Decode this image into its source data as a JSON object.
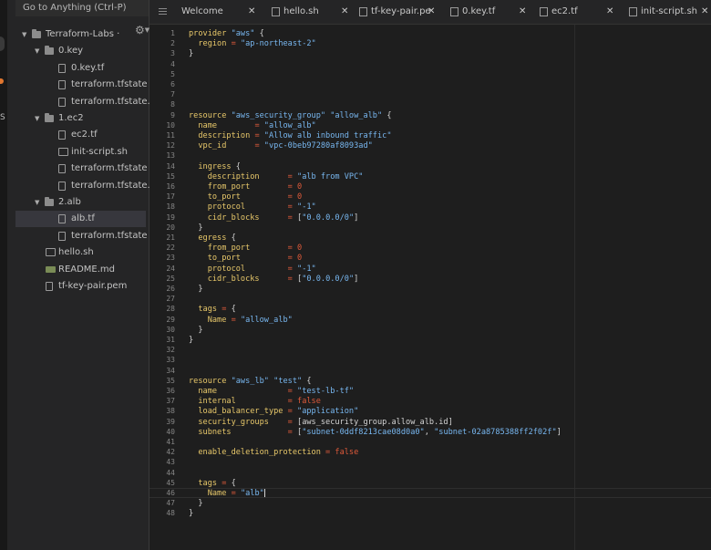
{
  "search": {
    "placeholder": "Go to Anything (Ctrl-P)"
  },
  "tree": [
    {
      "label": "Terraform-Labs ·",
      "type": "folder",
      "expanded": true,
      "depth": 0,
      "icon": "folder-icon"
    },
    {
      "label": "0.key",
      "type": "folder",
      "expanded": true,
      "depth": 1,
      "icon": "folder-icon"
    },
    {
      "label": "0.key.tf",
      "type": "file",
      "depth": 2,
      "icon": "file-icon"
    },
    {
      "label": "terraform.tfstate",
      "type": "file",
      "depth": 2,
      "icon": "file-icon"
    },
    {
      "label": "terraform.tfstate.ba",
      "type": "file",
      "depth": 2,
      "icon": "file-icon"
    },
    {
      "label": "1.ec2",
      "type": "folder",
      "expanded": true,
      "depth": 1,
      "icon": "folder-icon"
    },
    {
      "label": "ec2.tf",
      "type": "file",
      "depth": 2,
      "icon": "file-icon"
    },
    {
      "label": "init-script.sh",
      "type": "file",
      "depth": 2,
      "icon": "terminal-file-icon"
    },
    {
      "label": "terraform.tfstate",
      "type": "file",
      "depth": 2,
      "icon": "file-icon"
    },
    {
      "label": "terraform.tfstate.ba",
      "type": "file",
      "depth": 2,
      "icon": "file-icon"
    },
    {
      "label": "2.alb",
      "type": "folder",
      "expanded": true,
      "depth": 1,
      "icon": "folder-icon"
    },
    {
      "label": "alb.tf",
      "type": "file",
      "depth": 2,
      "icon": "file-icon",
      "selected": true
    },
    {
      "label": "terraform.tfstate",
      "type": "file",
      "depth": 2,
      "icon": "file-icon"
    },
    {
      "label": "hello.sh",
      "type": "file",
      "depth": 1,
      "icon": "terminal-file-icon"
    },
    {
      "label": "README.md",
      "type": "file",
      "depth": 1,
      "icon": "markdown-file-icon"
    },
    {
      "label": "tf-key-pair.pem",
      "type": "file",
      "depth": 1,
      "icon": "file-icon"
    }
  ],
  "tabs": [
    {
      "label": "Welcome",
      "icon": null
    },
    {
      "label": "hello.sh",
      "icon": "terminal-file-icon"
    },
    {
      "label": "tf-key-pair.pe",
      "icon": "file-icon"
    },
    {
      "label": "0.key.tf",
      "icon": "file-icon"
    },
    {
      "label": "ec2.tf",
      "icon": "file-icon"
    },
    {
      "label": "init-script.sh",
      "icon": "terminal-file-icon"
    }
  ],
  "tab_close_glyph": "✕",
  "editor": {
    "active_line": 46,
    "lines": [
      [
        [
          "kw",
          "provider "
        ],
        [
          "str",
          "\"aws\""
        ],
        [
          "brace",
          " {"
        ]
      ],
      [
        [
          "kw",
          "  region "
        ],
        [
          "op",
          "= "
        ],
        [
          "str",
          "\"ap-northeast-2\""
        ]
      ],
      [
        [
          "brace",
          "}"
        ]
      ],
      [],
      [],
      [],
      [],
      [],
      [
        [
          "kw",
          "resource "
        ],
        [
          "str",
          "\"aws_security_group\" \"allow_alb\""
        ],
        [
          "brace",
          " {"
        ]
      ],
      [
        [
          "kw",
          "  name        "
        ],
        [
          "op",
          "= "
        ],
        [
          "str",
          "\"allow_alb\""
        ]
      ],
      [
        [
          "kw",
          "  description "
        ],
        [
          "op",
          "= "
        ],
        [
          "str",
          "\"Allow alb inbound traffic\""
        ]
      ],
      [
        [
          "kw",
          "  vpc_id      "
        ],
        [
          "op",
          "= "
        ],
        [
          "str",
          "\"vpc-0beb97280af8093ad\""
        ]
      ],
      [],
      [
        [
          "kw",
          "  ingress "
        ],
        [
          "brace",
          "{"
        ]
      ],
      [
        [
          "kw",
          "    description      "
        ],
        [
          "op",
          "= "
        ],
        [
          "str",
          "\"alb from VPC\""
        ]
      ],
      [
        [
          "kw",
          "    from_port        "
        ],
        [
          "op",
          "= "
        ],
        [
          "num",
          "0"
        ]
      ],
      [
        [
          "kw",
          "    to_port          "
        ],
        [
          "op",
          "= "
        ],
        [
          "num",
          "0"
        ]
      ],
      [
        [
          "kw",
          "    protocol         "
        ],
        [
          "op",
          "= "
        ],
        [
          "str",
          "\"-1\""
        ]
      ],
      [
        [
          "kw",
          "    cidr_blocks      "
        ],
        [
          "op",
          "= "
        ],
        [
          "brace",
          "["
        ],
        [
          "str",
          "\"0.0.0.0/0\""
        ],
        [
          "brace",
          "]"
        ]
      ],
      [
        [
          "brace",
          "  }"
        ]
      ],
      [
        [
          "kw",
          "  egress "
        ],
        [
          "brace",
          "{"
        ]
      ],
      [
        [
          "kw",
          "    from_port        "
        ],
        [
          "op",
          "= "
        ],
        [
          "num",
          "0"
        ]
      ],
      [
        [
          "kw",
          "    to_port          "
        ],
        [
          "op",
          "= "
        ],
        [
          "num",
          "0"
        ]
      ],
      [
        [
          "kw",
          "    protocol         "
        ],
        [
          "op",
          "= "
        ],
        [
          "str",
          "\"-1\""
        ]
      ],
      [
        [
          "kw",
          "    cidr_blocks      "
        ],
        [
          "op",
          "= "
        ],
        [
          "brace",
          "["
        ],
        [
          "str",
          "\"0.0.0.0/0\""
        ],
        [
          "brace",
          "]"
        ]
      ],
      [
        [
          "brace",
          "  }"
        ]
      ],
      [],
      [
        [
          "kw",
          "  tags "
        ],
        [
          "op",
          "= "
        ],
        [
          "brace",
          "{"
        ]
      ],
      [
        [
          "kw",
          "    Name "
        ],
        [
          "op",
          "= "
        ],
        [
          "str",
          "\"allow_alb\""
        ]
      ],
      [
        [
          "brace",
          "  }"
        ]
      ],
      [
        [
          "brace",
          "}"
        ]
      ],
      [],
      [],
      [],
      [
        [
          "kw",
          "resource "
        ],
        [
          "str",
          "\"aws_lb\" \"test\""
        ],
        [
          "brace",
          " {"
        ]
      ],
      [
        [
          "kw",
          "  name               "
        ],
        [
          "op",
          "= "
        ],
        [
          "str",
          "\"test-lb-tf\""
        ]
      ],
      [
        [
          "kw",
          "  internal           "
        ],
        [
          "op",
          "= "
        ],
        [
          "num",
          "false"
        ]
      ],
      [
        [
          "kw",
          "  load_balancer_type "
        ],
        [
          "op",
          "= "
        ],
        [
          "str",
          "\"application\""
        ]
      ],
      [
        [
          "kw",
          "  security_groups    "
        ],
        [
          "op",
          "= "
        ],
        [
          "brace",
          "[aws_security_group.allow_alb.id]"
        ]
      ],
      [
        [
          "kw",
          "  subnets            "
        ],
        [
          "op",
          "= "
        ],
        [
          "brace",
          "["
        ],
        [
          "str",
          "\"subnet-0ddf8213cae08d0a0\""
        ],
        [
          "brace",
          ", "
        ],
        [
          "str",
          "\"subnet-02a8785388ff2f02f\""
        ],
        [
          "brace",
          "]"
        ]
      ],
      [],
      [
        [
          "kw",
          "  enable_deletion_protection "
        ],
        [
          "op",
          "= "
        ],
        [
          "num",
          "false"
        ]
      ],
      [],
      [],
      [
        [
          "kw",
          "  tags "
        ],
        [
          "op",
          "= "
        ],
        [
          "brace",
          "{"
        ]
      ],
      [
        [
          "kw",
          "    Name "
        ],
        [
          "op",
          "= "
        ],
        [
          "str",
          "\"alb\""
        ]
      ],
      [
        [
          "brace",
          "  }"
        ]
      ],
      [
        [
          "brace",
          "}"
        ]
      ]
    ]
  }
}
